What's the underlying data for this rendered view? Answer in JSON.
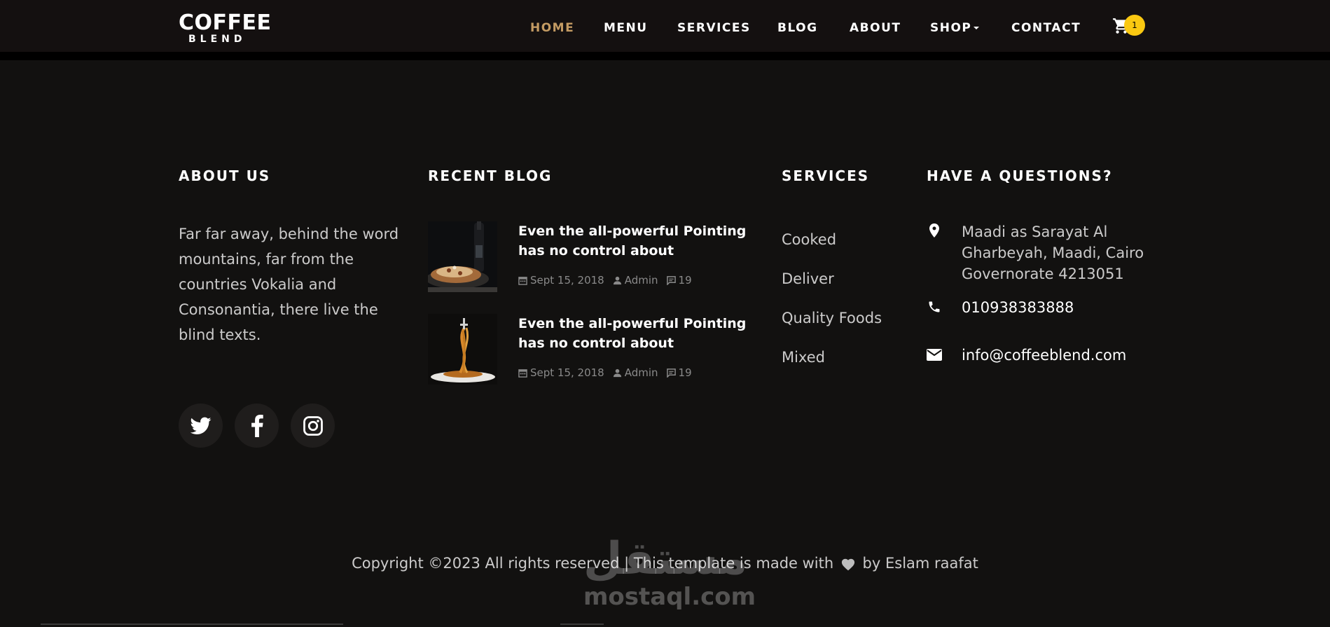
{
  "brand": {
    "line1": "COFFEE",
    "line2": "BLEND"
  },
  "nav": {
    "items": [
      {
        "label": "HOME"
      },
      {
        "label": "MENU"
      },
      {
        "label": "SERVICES"
      },
      {
        "label": "BLOG"
      },
      {
        "label": "ABOUT"
      },
      {
        "label": "SHOP"
      },
      {
        "label": "CONTACT"
      }
    ],
    "active": "HOME",
    "cart_count": "1"
  },
  "about": {
    "title": "ABOUT US",
    "text": "Far far away, behind the word mountains, far from the countries Vokalia and Consonantia, there live the blind texts.",
    "social": [
      "twitter-icon",
      "facebook-icon",
      "instagram-icon"
    ]
  },
  "recent_blog": {
    "title": "RECENT BLOG",
    "posts": [
      {
        "title": "Even the all-powerful Pointing has no control about",
        "date": "Sept 15, 2018",
        "author": "Admin",
        "comments": "19"
      },
      {
        "title": "Even the all-powerful Pointing has no control about",
        "date": "Sept 15, 2018",
        "author": "Admin",
        "comments": "19"
      }
    ]
  },
  "services": {
    "title": "SERVICES",
    "items": [
      "Cooked",
      "Deliver",
      "Quality Foods",
      "Mixed"
    ]
  },
  "contact": {
    "title": "HAVE A QUESTIONS?",
    "address": "Maadi as Sarayat Al Gharbeyah, Maadi, Cairo Governorate 4213051",
    "phone": "010938383888",
    "email": "info@coffeeblend.com"
  },
  "footer": {
    "copyright_pre": "Copyright ©2023 All rights reserved | This template is made with",
    "copyright_post": "by Eslam raafat"
  },
  "watermark": {
    "arabic": "مستقل",
    "latin": "mostaql.com"
  },
  "colors": {
    "accent": "#c49b63",
    "badge": "#fac811",
    "background": "#121110"
  }
}
